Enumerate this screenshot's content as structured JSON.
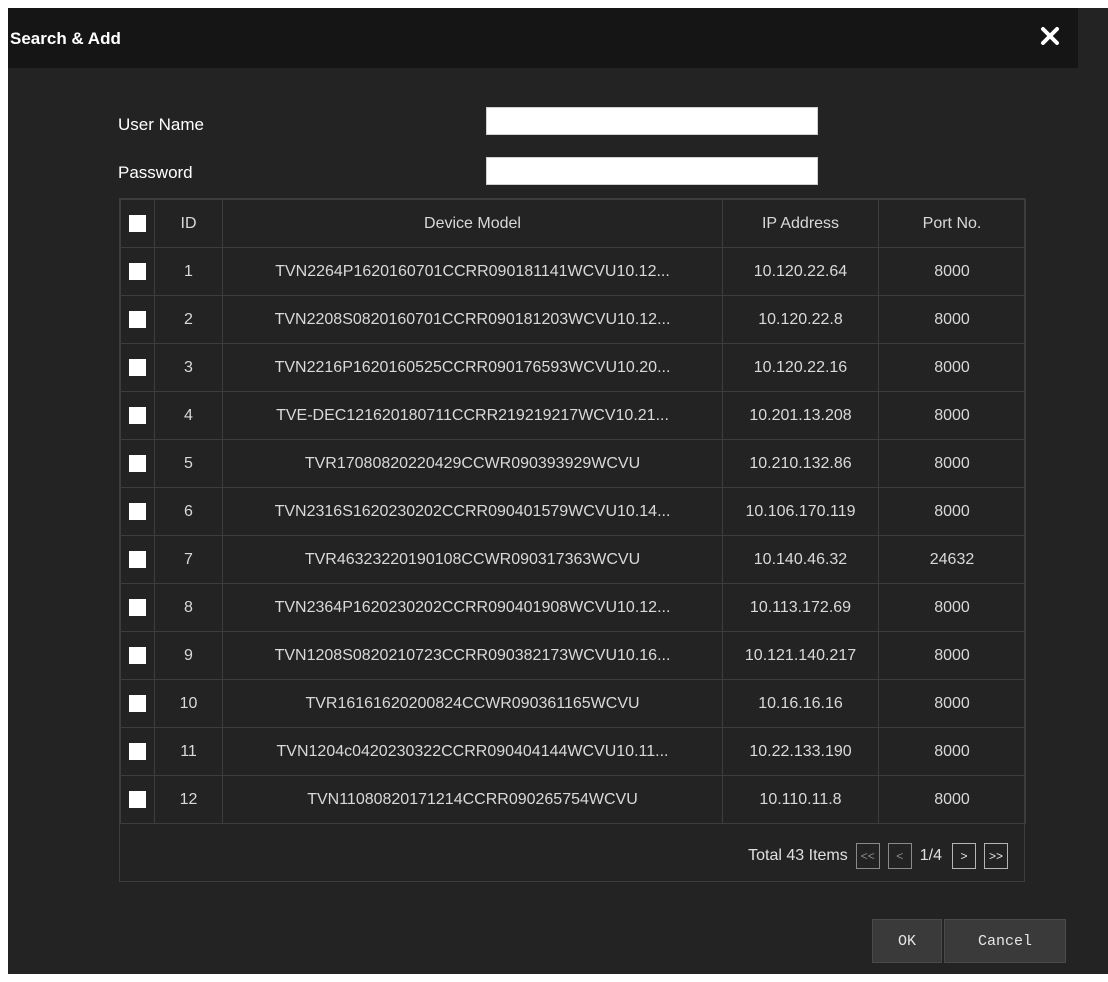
{
  "dialog": {
    "title": "Search & Add",
    "close_icon": "close-icon"
  },
  "form": {
    "username_label": "User Name",
    "username_value": "",
    "password_label": "Password",
    "password_value": ""
  },
  "table": {
    "columns": [
      "ID",
      "Device Model",
      "IP Address",
      "Port No."
    ],
    "rows": [
      {
        "id": "1",
        "model": "TVN2264P1620160701CCRR090181141WCVU10.12...",
        "ip": "10.120.22.64",
        "port": "8000"
      },
      {
        "id": "2",
        "model": "TVN2208S0820160701CCRR090181203WCVU10.12...",
        "ip": "10.120.22.8",
        "port": "8000"
      },
      {
        "id": "3",
        "model": "TVN2216P1620160525CCRR090176593WCVU10.20...",
        "ip": "10.120.22.16",
        "port": "8000"
      },
      {
        "id": "4",
        "model": "TVE-DEC121620180711CCRR219219217WCV10.21...",
        "ip": "10.201.13.208",
        "port": "8000"
      },
      {
        "id": "5",
        "model": "TVR17080820220429CCWR090393929WCVU",
        "ip": "10.210.132.86",
        "port": "8000"
      },
      {
        "id": "6",
        "model": "TVN2316S1620230202CCRR090401579WCVU10.14...",
        "ip": "10.106.170.119",
        "port": "8000"
      },
      {
        "id": "7",
        "model": "TVR46323220190108CCWR090317363WCVU",
        "ip": "10.140.46.32",
        "port": "24632"
      },
      {
        "id": "8",
        "model": "TVN2364P1620230202CCRR090401908WCVU10.12...",
        "ip": "10.113.172.69",
        "port": "8000"
      },
      {
        "id": "9",
        "model": "TVN1208S0820210723CCRR090382173WCVU10.16...",
        "ip": "10.121.140.217",
        "port": "8000"
      },
      {
        "id": "10",
        "model": "TVR16161620200824CCWR090361165WCVU",
        "ip": "10.16.16.16",
        "port": "8000"
      },
      {
        "id": "11",
        "model": "TVN1204c0420230322CCRR090404144WCVU10.11...",
        "ip": "10.22.133.190",
        "port": "8000"
      },
      {
        "id": "12",
        "model": "TVN11080820171214CCRR090265754WCVU",
        "ip": "10.110.11.8",
        "port": "8000"
      }
    ]
  },
  "pagination": {
    "total_text": "Total 43 Items",
    "first_label": "<<",
    "prev_label": "<",
    "page_text": "1/4",
    "next_label": ">",
    "last_label": ">>"
  },
  "footer": {
    "ok_label": "OK",
    "cancel_label": "Cancel"
  },
  "colors": {
    "dialog_bg": "#232323",
    "title_bg": "#151515",
    "border": "#3d3d3d",
    "text": "#d9d9d9"
  }
}
